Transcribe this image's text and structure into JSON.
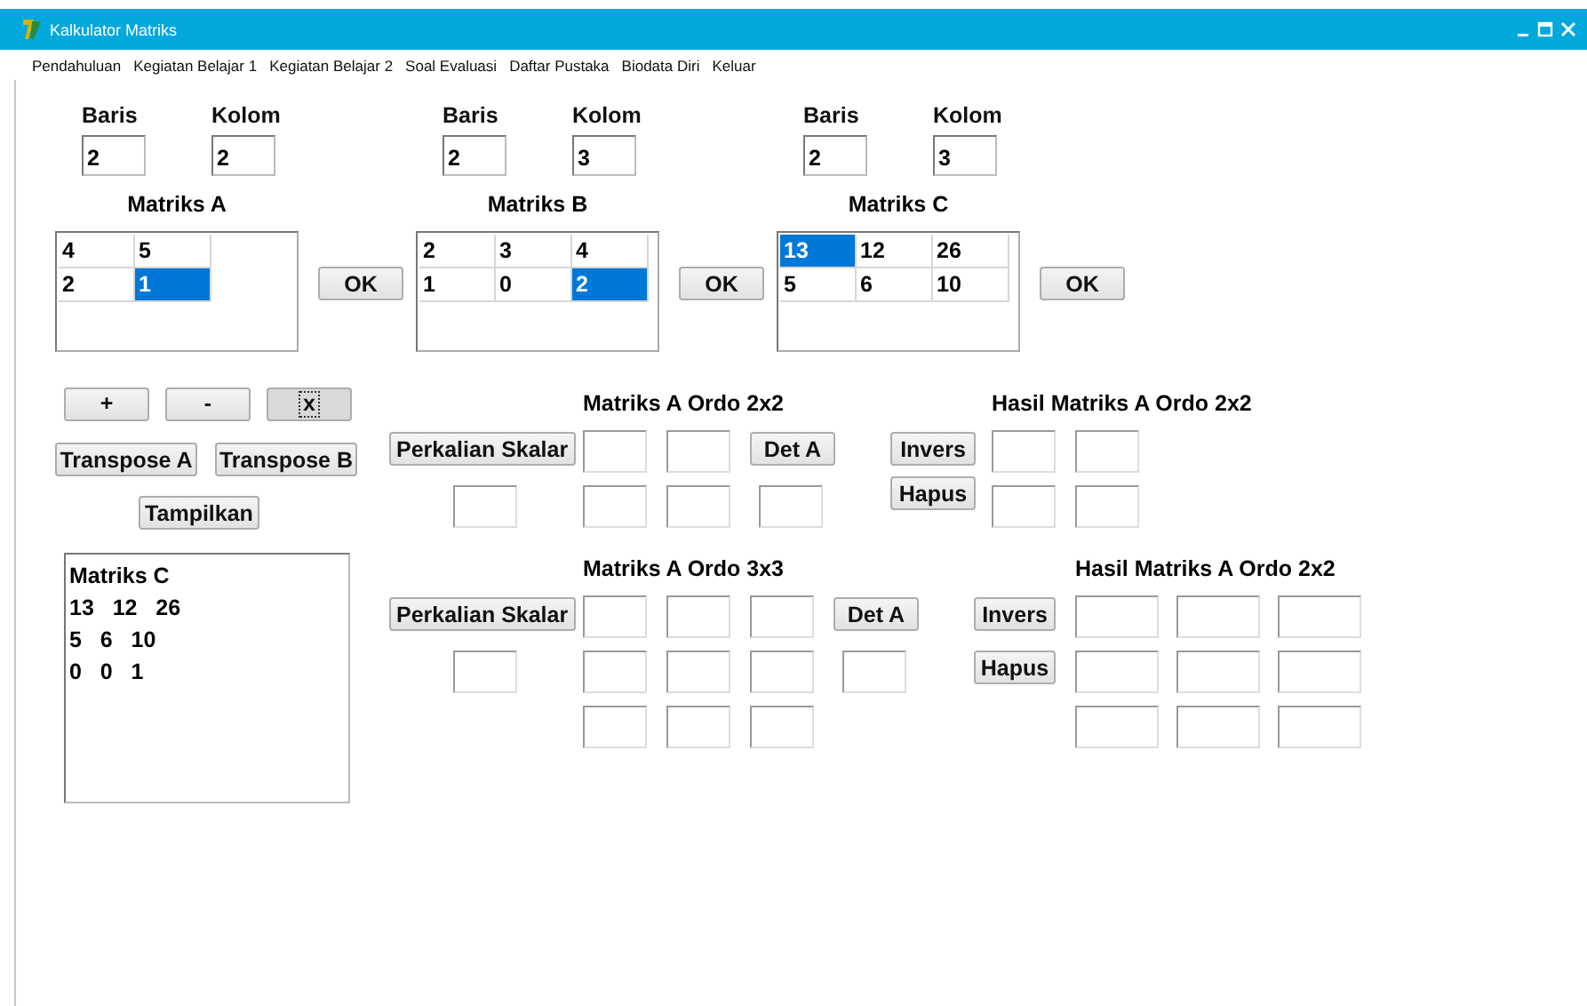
{
  "window": {
    "title": "Kalkulator Matriks"
  },
  "menu": [
    "Pendahuluan",
    "Kegiatan Belajar 1",
    "Kegiatan Belajar 2",
    "Soal Evaluasi",
    "Daftar Pustaka",
    "Biodata Diri",
    "Keluar"
  ],
  "matrices": [
    {
      "rows_label": "Baris",
      "rows": "2",
      "cols_label": "Kolom",
      "cols": "2",
      "title": "Matriks A",
      "ok": "OK",
      "cells": [
        [
          {
            "value": "4",
            "selected": false
          },
          {
            "value": "5",
            "selected": false
          }
        ],
        [
          {
            "value": "2",
            "selected": false
          },
          {
            "value": "1",
            "selected": true
          }
        ]
      ]
    },
    {
      "rows_label": "Baris",
      "rows": "2",
      "cols_label": "Kolom",
      "cols": "3",
      "title": "Matriks B",
      "ok": "OK",
      "cells": [
        [
          {
            "value": "2",
            "selected": false
          },
          {
            "value": "3",
            "selected": false
          },
          {
            "value": "4",
            "selected": false
          }
        ],
        [
          {
            "value": "1",
            "selected": false
          },
          {
            "value": "0",
            "selected": false
          },
          {
            "value": "2",
            "selected": true
          }
        ]
      ]
    },
    {
      "rows_label": "Baris",
      "rows": "2",
      "cols_label": "Kolom",
      "cols": "3",
      "title": "Matriks C",
      "ok": "OK",
      "cells": [
        [
          {
            "value": "13",
            "selected": true
          },
          {
            "value": "12",
            "selected": false
          },
          {
            "value": "26",
            "selected": false
          }
        ],
        [
          {
            "value": "5",
            "selected": false
          },
          {
            "value": "6",
            "selected": false
          },
          {
            "value": "10",
            "selected": false
          }
        ]
      ]
    }
  ],
  "operations": [
    {
      "label": "+",
      "pressed": false
    },
    {
      "label": "-",
      "pressed": false
    },
    {
      "label": "x",
      "pressed": true
    }
  ],
  "transpose": [
    "Transpose A",
    "Transpose B"
  ],
  "show_button": "Tampilkan",
  "output_lines": [
    "Matriks C",
    "13   12   26",
    "5   6   10",
    "0   0   1"
  ],
  "ordo_blocks": [
    {
      "kind": "square2",
      "title": "Matriks A Ordo 2x2",
      "scalar_button": "Perkalian Skalar",
      "det_button": "Det A",
      "result_title": "Hasil Matriks A Ordo 2x2",
      "inverse_button": "Invers",
      "clear_button": "Hapus"
    },
    {
      "kind": "square3",
      "title": "Matriks A Ordo 3x3",
      "scalar_button": "Perkalian Skalar",
      "det_button": "Det A",
      "result_title": "Hasil Matriks A Ordo 2x2",
      "inverse_button": "Invers",
      "clear_button": "Hapus"
    }
  ]
}
